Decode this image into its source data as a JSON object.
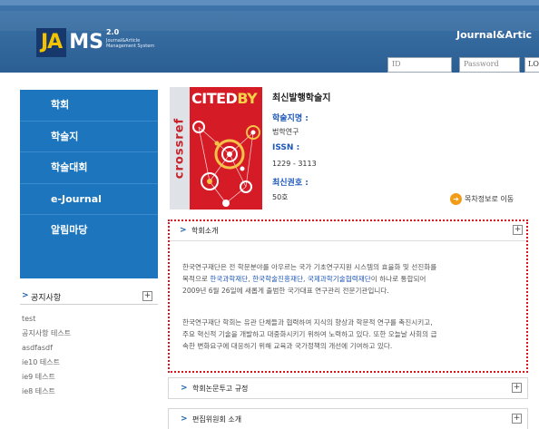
{
  "header": {
    "logo_ja": "JA",
    "logo_ms": "MS",
    "logo_version": "2.0",
    "logo_subtitle_1": "Journal&Article",
    "logo_subtitle_2": "Management System",
    "journal_tab": "Journal&Artic",
    "id_placeholder": "ID",
    "password_placeholder": "Password",
    "login_label": "LO"
  },
  "leftnav": {
    "items": [
      "학회",
      "학술지",
      "학술대회",
      "e-Journal",
      "알림마당"
    ]
  },
  "notice": {
    "title": "공지사항",
    "items": [
      "test",
      "공지사항 테스트",
      "asdfasdf",
      "ie10 테스트",
      "ie9 테스트",
      "ie8 테스트"
    ]
  },
  "journal": {
    "section_title": "최신발행학술지",
    "name_label": "학술지명 :",
    "name_value": "법학연구",
    "issn_label": "ISSN :",
    "issn_value": "1229 - 3113",
    "issue_label": "최신권호 :",
    "issue_value": "50호",
    "toc_button": "목차정보로 이동",
    "cover_citedby_1": "CITED",
    "cover_citedby_2": "BY",
    "cover_crossref": "crossref"
  },
  "intro": {
    "title": "학회소개",
    "p1_a": "한국연구재단은 전 학문분야를 아우르는 국가 기초연구지원 시스템의 효율화 및 선진화를",
    "p1_b": "목적으로 ",
    "p1_hl1": "한국과학재단",
    "p1_sep1": ", ",
    "p1_hl2": "한국학술진흥재단",
    "p1_sep2": ", ",
    "p1_hl3": "국제과학기술협력재단",
    "p1_c": "이 하나로 통합되어",
    "p1_d": "2009년 6월 26일에 새롭게 출범한 국가대표 연구관리 전문기관입니다.",
    "p2_a": "한국연구재단 학회는 유관 단체들과 협력하여 지식의 향상과 학문적 연구를 촉진시키고,",
    "p2_b": "주요 혁신적 기술을 개발하고 대중화시키기 위하여 노력하고 있다. 또한 오늘날 사회의 급",
    "p2_c": "속한 변화요구에 대응하기 위해 교육과 국가정책의 개선에 기여하고 있다."
  },
  "sections": {
    "submission_rules": "학회논문투고 규정",
    "editorial_board": "편집위원회 소개"
  },
  "colors": {
    "header_blue": "#2b5f93",
    "nav_blue": "#1d76bd",
    "highlight_blue": "#1c57b8",
    "dotted_red": "#d7171d",
    "toc_orange": "#f29b17"
  }
}
